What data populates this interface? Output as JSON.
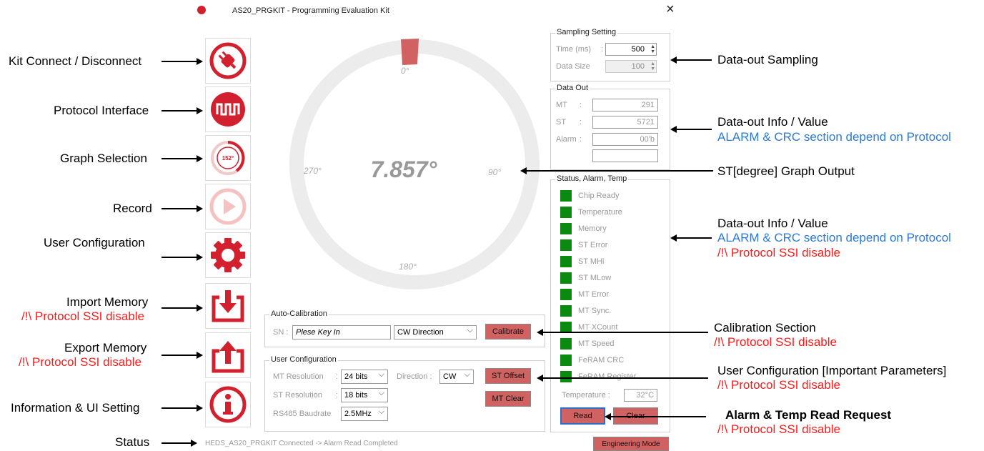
{
  "window": {
    "title": "AS20_PRGKIT - Programming Evaluation Kit",
    "close": "×"
  },
  "annotations": {
    "kit_connect": "Kit Connect / Disconnect",
    "protocol": "Protocol Interface",
    "graph": "Graph Selection",
    "record": "Record",
    "user_config": "User Configuration",
    "import_memory": "Import Memory",
    "import_warn": "/!\\ Protocol SSI disable",
    "export_memory": "Export Memory",
    "export_warn": "/!\\ Protocol SSI disable",
    "info": "Information & UI Setting",
    "status": "Status",
    "data_sampling": "Data-out Sampling",
    "data_info1": "Data-out Info / Value",
    "data_info1_sub": "ALARM & CRC section depend on Protocol",
    "st_graph": "ST[degree] Graph Output",
    "data_info2": "Data-out Info / Value",
    "data_info2_sub": "ALARM & CRC section depend on Protocol",
    "data_info2_warn": "/!\\ Protocol SSI disable",
    "calib": "Calibration Section",
    "calib_warn": "/!\\ Protocol SSI disable",
    "user_params": "User Configuration [Important Parameters]",
    "user_params_warn": "/!\\ Protocol SSI disable",
    "alarm_read": "Alarm & Temp Read Request",
    "alarm_warn": "/!\\ Protocol SSI disable"
  },
  "sidebar": {
    "graph_badge": "152°"
  },
  "gauge": {
    "value": "7.857°",
    "t0": "0°",
    "t90": "90°",
    "t180": "180°",
    "t270": "270°"
  },
  "sampling": {
    "title": "Sampling Setting",
    "time_label": "Time (ms)",
    "time_value": "500",
    "size_label": "Data Size",
    "size_value": "100"
  },
  "data_out": {
    "title": "Data Out",
    "mt_label": "MT",
    "mt_value": "291",
    "st_label": "ST",
    "st_value": "5721",
    "alarm_label": "Alarm",
    "alarm_value": "00'b",
    "extra_value": ""
  },
  "status_panel": {
    "title": "Status, Alarm, Temp",
    "items": [
      "Chip Ready",
      "Temperature",
      "Memory",
      "ST Error",
      "ST MHi",
      "ST MLow",
      "MT Error",
      "MT Sync.",
      "MT XCount",
      "MT Speed",
      "FeRAM CRC",
      "FeRAM Register"
    ],
    "temp_label": "Temperature :",
    "temp_value": "32°C",
    "read": "Read",
    "clear": "Clear"
  },
  "autocal": {
    "title": "Auto-Calibration",
    "sn_label": "SN :",
    "sn_placeholder": "Plese Key In",
    "direction": "CW Direction",
    "calibrate": "Calibrate"
  },
  "usercfg": {
    "title": "User Configuration",
    "mt_res_label": "MT Resolution",
    "mt_res": "24 bits",
    "st_res_label": "ST Resolution",
    "st_res": "18 bits",
    "baud_label": "RS485 Baudrate",
    "baud": "2.5MHz",
    "dir_label": "Direction :",
    "dir": "CW",
    "st_offset": "ST Offset",
    "mt_clear": "MT Clear"
  },
  "statusbar": {
    "text": "HEDS_AS20_PRGKIT Connected -> Alarm Read Completed",
    "eng_mode": "Engineering Mode"
  },
  "colors": {
    "accent": "#d3202f",
    "led": "#0b8a10",
    "button": "#d06262"
  }
}
